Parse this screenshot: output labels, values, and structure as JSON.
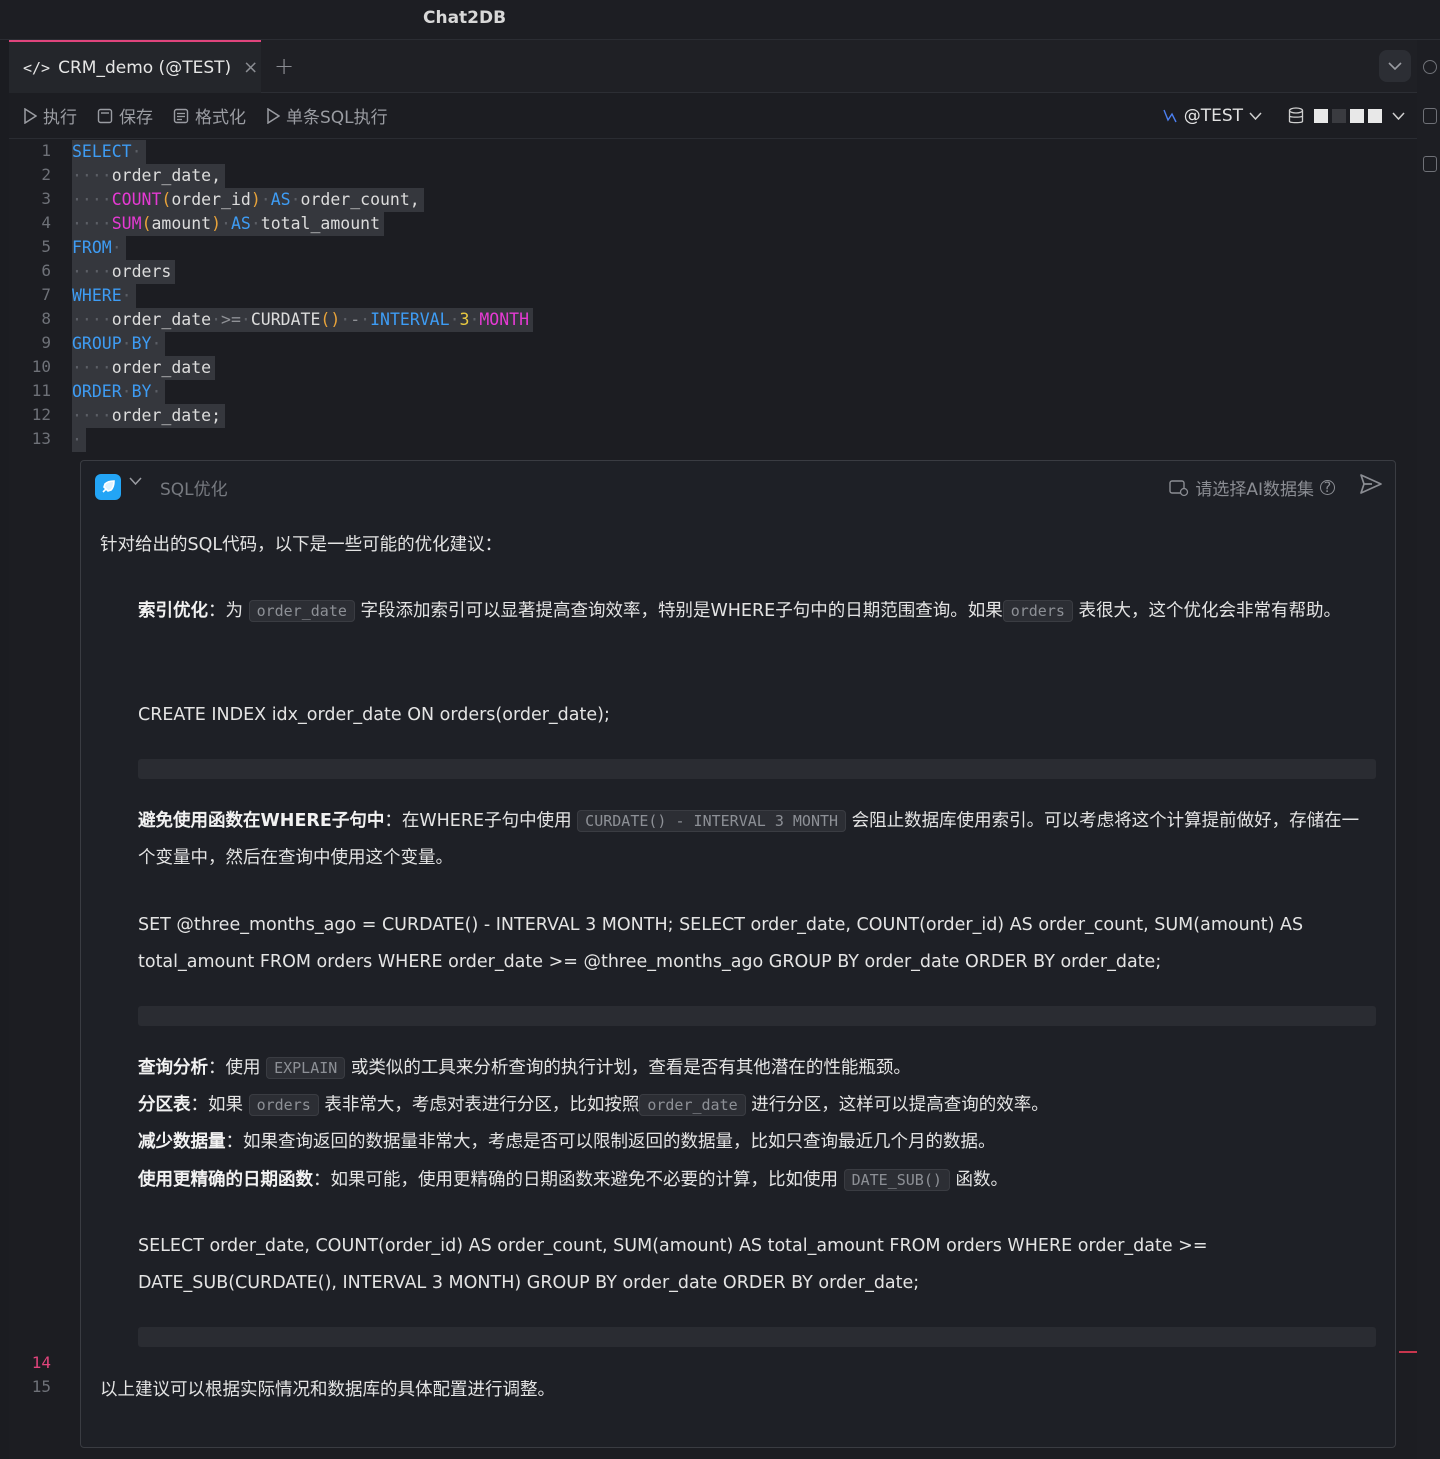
{
  "app": {
    "title": "Chat2DB"
  },
  "tabs": [
    {
      "icon": "</>",
      "label": "CRM_demo (@TEST)",
      "close": "×"
    }
  ],
  "tabbar": {
    "add": "+",
    "dropdown": "⌄"
  },
  "toolbar": {
    "run": "执行",
    "save": "保存",
    "format": "格式化",
    "single_run": "单条SQL执行",
    "connection": "@TEST"
  },
  "editor": {
    "line_numbers": [
      "1",
      "2",
      "3",
      "4",
      "5",
      "6",
      "7",
      "8",
      "9",
      "10",
      "11",
      "12",
      "13",
      "14",
      "15"
    ],
    "active_line": "14",
    "code_lines": [
      [
        [
          "kw",
          "SELECT"
        ],
        [
          "dot",
          "·"
        ]
      ],
      [
        [
          "dot",
          "····"
        ],
        [
          "id",
          "order_date,"
        ]
      ],
      [
        [
          "dot",
          "····"
        ],
        [
          "fn",
          "COUNT"
        ],
        [
          "pn",
          "("
        ],
        [
          "id",
          "order_id"
        ],
        [
          "pn",
          ")"
        ],
        [
          "dot",
          "·"
        ],
        [
          "kw",
          "AS"
        ],
        [
          "dot",
          "·"
        ],
        [
          "id",
          "order_count,"
        ]
      ],
      [
        [
          "dot",
          "····"
        ],
        [
          "fn",
          "SUM"
        ],
        [
          "pn",
          "("
        ],
        [
          "id",
          "amount"
        ],
        [
          "pn",
          ")"
        ],
        [
          "dot",
          "·"
        ],
        [
          "kw",
          "AS"
        ],
        [
          "dot",
          "·"
        ],
        [
          "id",
          "total_amount"
        ]
      ],
      [
        [
          "kw",
          "FROM"
        ],
        [
          "dot",
          "·"
        ]
      ],
      [
        [
          "dot",
          "····"
        ],
        [
          "id",
          "orders"
        ]
      ],
      [
        [
          "kw",
          "WHERE"
        ],
        [
          "dot",
          "·"
        ]
      ],
      [
        [
          "dot",
          "····"
        ],
        [
          "id",
          "order_date"
        ],
        [
          "dot",
          "·"
        ],
        [
          "op",
          ">="
        ],
        [
          "dot",
          "·"
        ],
        [
          "id",
          "CURDATE"
        ],
        [
          "pn",
          "()"
        ],
        [
          "dot",
          "·"
        ],
        [
          "op",
          "-"
        ],
        [
          "dot",
          "·"
        ],
        [
          "kw",
          "INTERVAL"
        ],
        [
          "dot",
          "·"
        ],
        [
          "num",
          "3"
        ],
        [
          "dot",
          "·"
        ],
        [
          "fn",
          "MONTH"
        ]
      ],
      [
        [
          "kw",
          "GROUP"
        ],
        [
          "dot",
          "·"
        ],
        [
          "kw",
          "BY"
        ],
        [
          "dot",
          "·"
        ]
      ],
      [
        [
          "dot",
          "····"
        ],
        [
          "id",
          "order_date"
        ]
      ],
      [
        [
          "kw",
          "ORDER"
        ],
        [
          "dot",
          "·"
        ],
        [
          "kw",
          "BY"
        ],
        [
          "dot",
          "·"
        ]
      ],
      [
        [
          "dot",
          "····"
        ],
        [
          "id",
          "order_date;"
        ]
      ],
      [
        [
          "dot",
          "·"
        ]
      ]
    ]
  },
  "ai": {
    "input_placeholder": "SQL优化",
    "dataset": "请选择AI数据集",
    "intro": "针对给出的SQL代码，以下是一些可能的优化建议：",
    "sections": {
      "index_title": "索引优化",
      "index_p1": "：为",
      "index_code1": "order_date",
      "index_p2": "字段添加索引可以显著提高查询效率，特别是WHERE子句中的日期范围查询。如果",
      "index_code2": "orders",
      "index_p3": "表很大，这个优化会非常有帮助。",
      "index_sql": "CREATE INDEX idx_order_date ON orders(order_date);",
      "func_title": "避免使用函数在WHERE子句中",
      "func_p1": "：在WHERE子句中使用",
      "func_code": "CURDATE() - INTERVAL 3 MONTH",
      "func_p2": "会阻止数据库使用索引。可以考虑将这个计算提前做好，存储在一个变量中，然后在查询中使用这个变量。",
      "func_sql": "SET @three_months_ago = CURDATE() - INTERVAL 3 MONTH; SELECT order_date, COUNT(order_id) AS order_count, SUM(amount) AS total_amount FROM orders WHERE order_date >= @three_months_ago GROUP BY order_date ORDER BY order_date;",
      "q_title": "查询分析",
      "q_p1": "：使用",
      "q_code": "EXPLAIN",
      "q_p2": "或类似的工具来分析查询的执行计划，查看是否有其他潜在的性能瓶颈。",
      "part_title": "分区表",
      "part_p1": "：如果",
      "part_code1": "orders",
      "part_p2": "表非常大，考虑对表进行分区，比如按照",
      "part_code2": "order_date",
      "part_p3": "进行分区，这样可以提高查询的效率。",
      "less_title": "减少数据量",
      "less_p1": "：如果查询返回的数据量非常大，考虑是否可以限制返回的数据量，比如只查询最近几个月的数据。",
      "date_title": "使用更精确的日期函数",
      "date_p1": "：如果可能，使用更精确的日期函数来避免不必要的计算，比如使用",
      "date_code": "DATE_SUB()",
      "date_p2": "函数。",
      "date_sql": "SELECT order_date, COUNT(order_id) AS order_count, SUM(amount) AS total_amount FROM orders WHERE order_date >= DATE_SUB(CURDATE(), INTERVAL 3 MONTH) GROUP BY order_date ORDER BY order_date;",
      "outro": "以上建议可以根据实际情况和数据库的具体配置进行调整。"
    }
  },
  "icons": {
    "run": "play-icon",
    "save": "save-icon",
    "format": "format-icon",
    "connection": "connection-icon",
    "database": "database-icon",
    "send": "send-icon",
    "dataset": "dataset-icon",
    "help": "help-icon"
  },
  "colors": {
    "accent": "#e0447c",
    "keyword": "#3e9cf4",
    "function": "#e53ad3",
    "ai_logo": "#23a5f6"
  }
}
